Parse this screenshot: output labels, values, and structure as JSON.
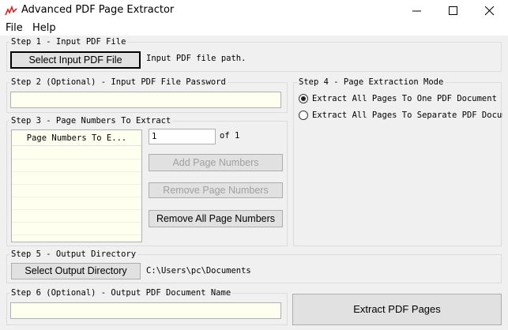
{
  "window": {
    "title": "Advanced PDF Page Extractor",
    "icon": "app-logo-icon"
  },
  "menu": {
    "items": [
      "File",
      "Help"
    ]
  },
  "step1": {
    "label": "Step 1 - Input PDF File",
    "button": "Select Input PDF File",
    "path_text": "Input PDF file path."
  },
  "step2": {
    "label": "Step 2 (Optional) - Input PDF File Password",
    "value": ""
  },
  "step3": {
    "label": "Step 3 - Page Numbers To Extract",
    "list_header": "Page Numbers To E...",
    "page_input_value": "1",
    "of_text": "of 1",
    "add_button": "Add Page Numbers",
    "remove_button": "Remove Page Numbers",
    "remove_all_button": "Remove All Page Numbers"
  },
  "step4": {
    "label": "Step 4 - Page Extraction Mode",
    "option_one": "Extract All Pages To One PDF Document",
    "option_separate": "Extract All Pages To Separate PDF Documen",
    "selected": "option_one"
  },
  "step5": {
    "label": "Step 5 - Output Directory",
    "button": "Select Output Directory",
    "path_text": "C:\\Users\\pc\\Documents"
  },
  "step6": {
    "label": "Step 6 (Optional) - Output PDF Document Name",
    "value": ""
  },
  "extract_button": "Extract PDF Pages"
}
